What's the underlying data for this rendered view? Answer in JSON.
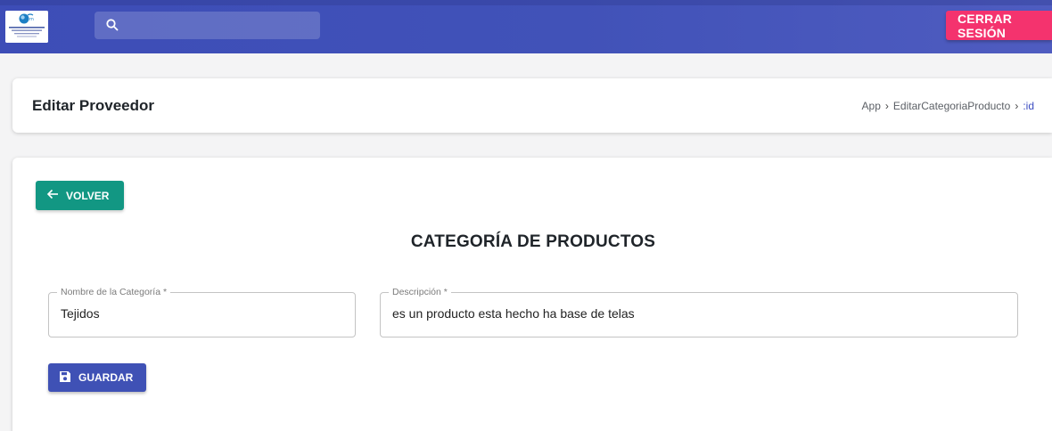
{
  "topbar": {
    "logout_label": "CERRAR SESIÓN",
    "search_placeholder": "",
    "color": "#3d4db7"
  },
  "header": {
    "title": "Editar Proveedor",
    "breadcrumb": [
      "App",
      "EditarCategoriaProducto",
      ":id"
    ]
  },
  "form": {
    "back_label": "VOLVER",
    "section_title": "CATEGORÍA DE PRODUCTOS",
    "fields": [
      {
        "label": "Nombre de la Categoría *",
        "value": "Tejidos"
      },
      {
        "label": "Descripción *",
        "value": "es un producto esta hecho ha base de telas"
      }
    ],
    "save_label": "GUARDAR"
  },
  "colors": {
    "back_button": "#129783",
    "save_button": "#3f51b5",
    "logout_button": "#f4336e"
  }
}
